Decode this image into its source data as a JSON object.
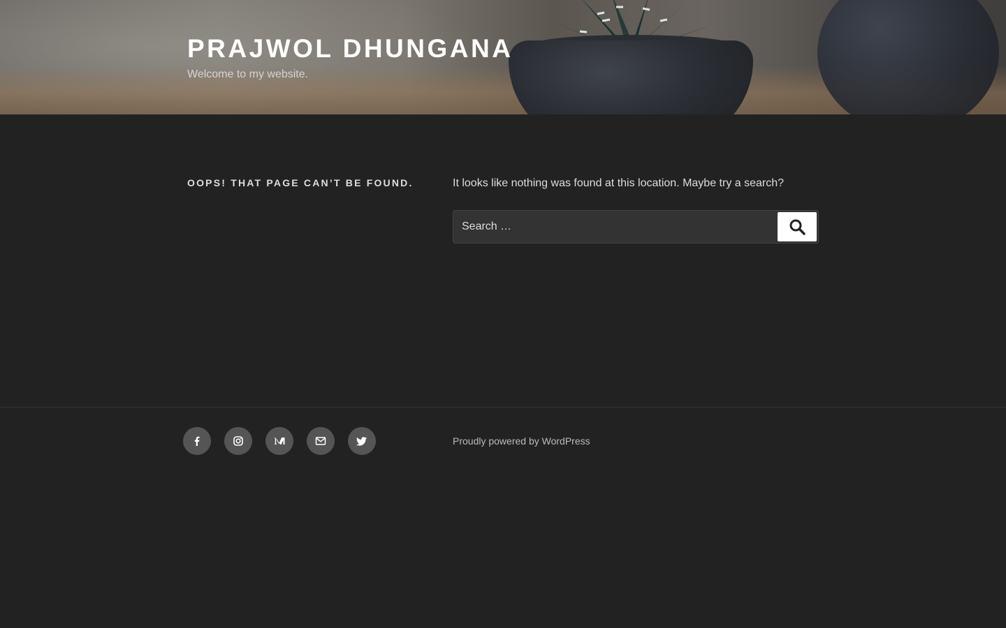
{
  "site": {
    "title": "Prajwol Dhungana",
    "description": "Welcome to my website."
  },
  "main": {
    "page_title": "Oops! That page can’t be found.",
    "message": "It looks like nothing was found at this location. Maybe try a search?",
    "search": {
      "placeholder": "Search …",
      "value": "",
      "button_icon": "search-icon"
    }
  },
  "footer": {
    "social_links": [
      {
        "name": "Facebook",
        "icon": "facebook-icon"
      },
      {
        "name": "Instagram",
        "icon": "instagram-icon"
      },
      {
        "name": "Medium",
        "icon": "medium-icon"
      },
      {
        "name": "Email",
        "icon": "envelope-icon"
      },
      {
        "name": "Twitter",
        "icon": "twitter-icon"
      }
    ],
    "powered_by": "Proudly powered by WordPress"
  },
  "colors": {
    "background": "#222222",
    "text": "#dddddd",
    "social_circle": "#555555",
    "search_button": "#ffffff"
  }
}
